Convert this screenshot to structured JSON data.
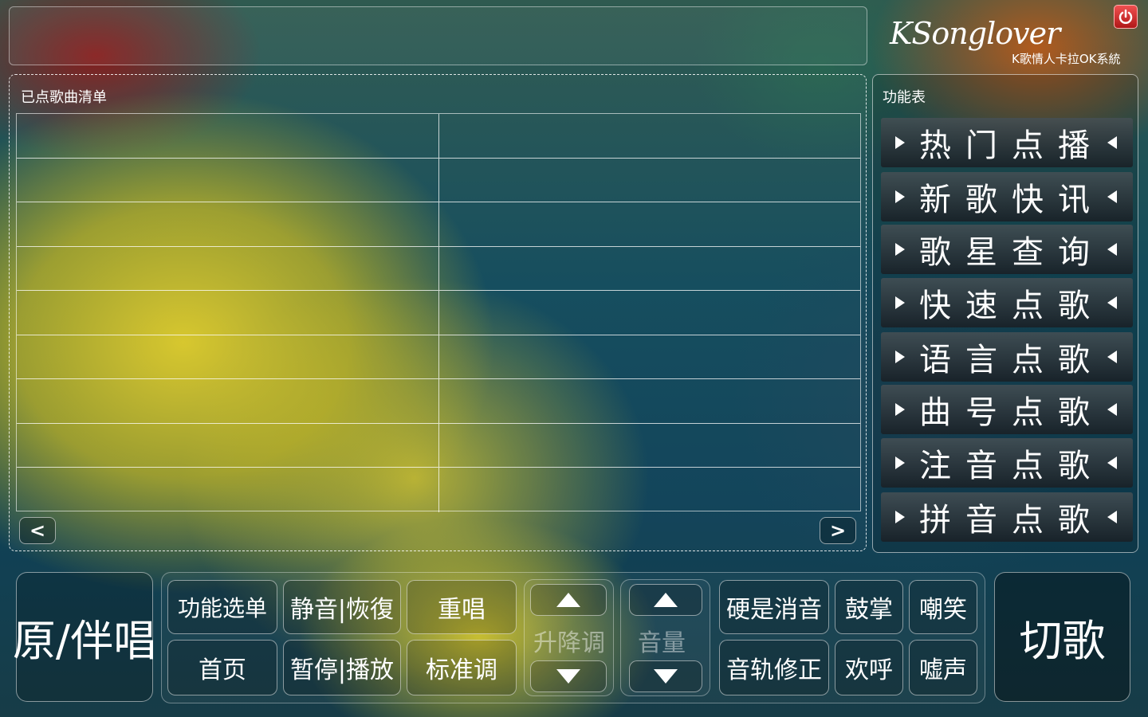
{
  "logo": {
    "brand": "KSonglover",
    "subtitle": "K歌情人卡拉OK系統"
  },
  "queue": {
    "title": "已点歌曲清单",
    "rows": [
      [
        "",
        ""
      ],
      [
        "",
        ""
      ],
      [
        "",
        ""
      ],
      [
        "",
        ""
      ],
      [
        "",
        ""
      ],
      [
        "",
        ""
      ],
      [
        "",
        ""
      ],
      [
        "",
        ""
      ],
      [
        "",
        ""
      ]
    ],
    "prev": "<",
    "next": ">"
  },
  "func_menu": {
    "title": "功能表",
    "items": [
      "热门点播",
      "新歌快讯",
      "歌星查询",
      "快速点歌",
      "语言点歌",
      "曲号点歌",
      "注音点歌",
      "拼音点歌"
    ]
  },
  "controls": {
    "vocal_toggle": "原/伴唱",
    "func_select": "功能选单",
    "mute_restore": "静音|恢復",
    "replay": "重唱",
    "home": "首页",
    "pause_play": "暂停|播放",
    "standard_key": "标准调",
    "key_label": "升降调",
    "volume_label": "音量",
    "hard_mute": "硬是消音",
    "applause": "鼓掌",
    "laugh": "嘲笑",
    "track_fix": "音轨修正",
    "cheer": "欢呼",
    "boo": "嘘声",
    "next_song": "切歌"
  }
}
